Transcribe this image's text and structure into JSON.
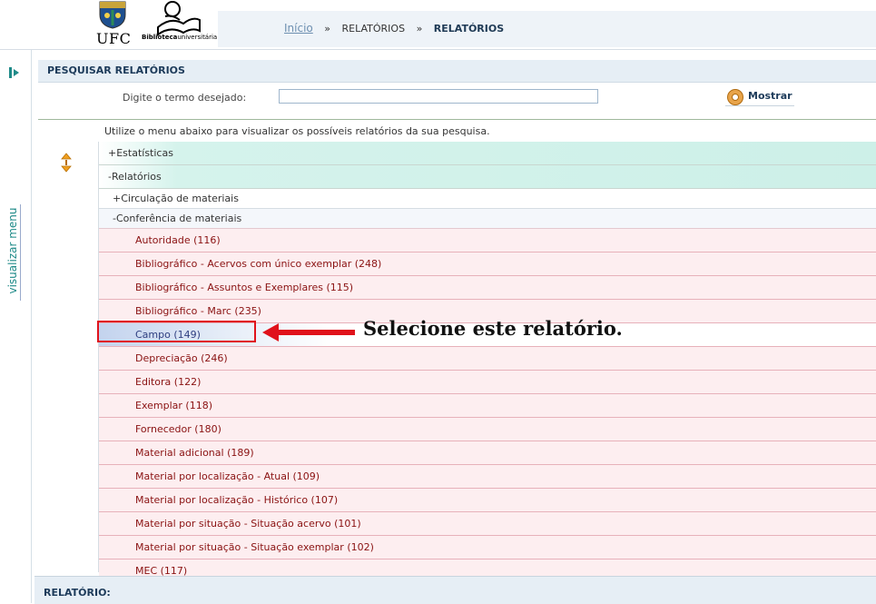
{
  "header": {
    "ufc_logo_text": "UFC",
    "library_logo_text_bold": "Biblioteca",
    "library_logo_text": "universitária",
    "breadcrumb": {
      "home": "Início",
      "separator": "»",
      "level1": "RELATÓRIOS",
      "level2": "RELATÓRIOS"
    }
  },
  "sidebar": {
    "toggle_icon": "show-menu-icon",
    "label": "visualizar menu"
  },
  "search_panel": {
    "title": "PESQUISAR RELATÓRIOS",
    "label": "Digite o termo desejado:",
    "input_value": "",
    "button_label": "Mostrar",
    "button_icon": "magnifier-icon"
  },
  "info_text": "Utilize o menu abaixo para visualizar os possíveis relatórios da sua pesquisa.",
  "tree": {
    "expand_icon": "expand-collapse-icon",
    "estatisticas": "+Estatísticas",
    "relatorios": "-Relatórios",
    "circulacao": "+Circulação de materiais",
    "conferencia": "-Conferência de materiais",
    "items": [
      "Autoridade (116)",
      "Bibliográfico - Acervos com único exemplar (248)",
      "Bibliográfico - Assuntos e Exemplares (115)",
      "Bibliográfico - Marc (235)",
      "Campo (149)",
      "Depreciação (246)",
      "Editora (122)",
      "Exemplar (118)",
      "Fornecedor (180)",
      "Material adicional (189)",
      "Material por localização - Atual (109)",
      "Material por localização - Histórico (107)",
      "Material por situação - Situação acervo (101)",
      "Material por situação - Situação exemplar (102)",
      "MEC (117)"
    ],
    "selected_index": 4
  },
  "annotation": {
    "callout_text": "Selecione este relatório.",
    "color": "#e0121b"
  },
  "footer": {
    "title": "RELATÓRIO:"
  }
}
